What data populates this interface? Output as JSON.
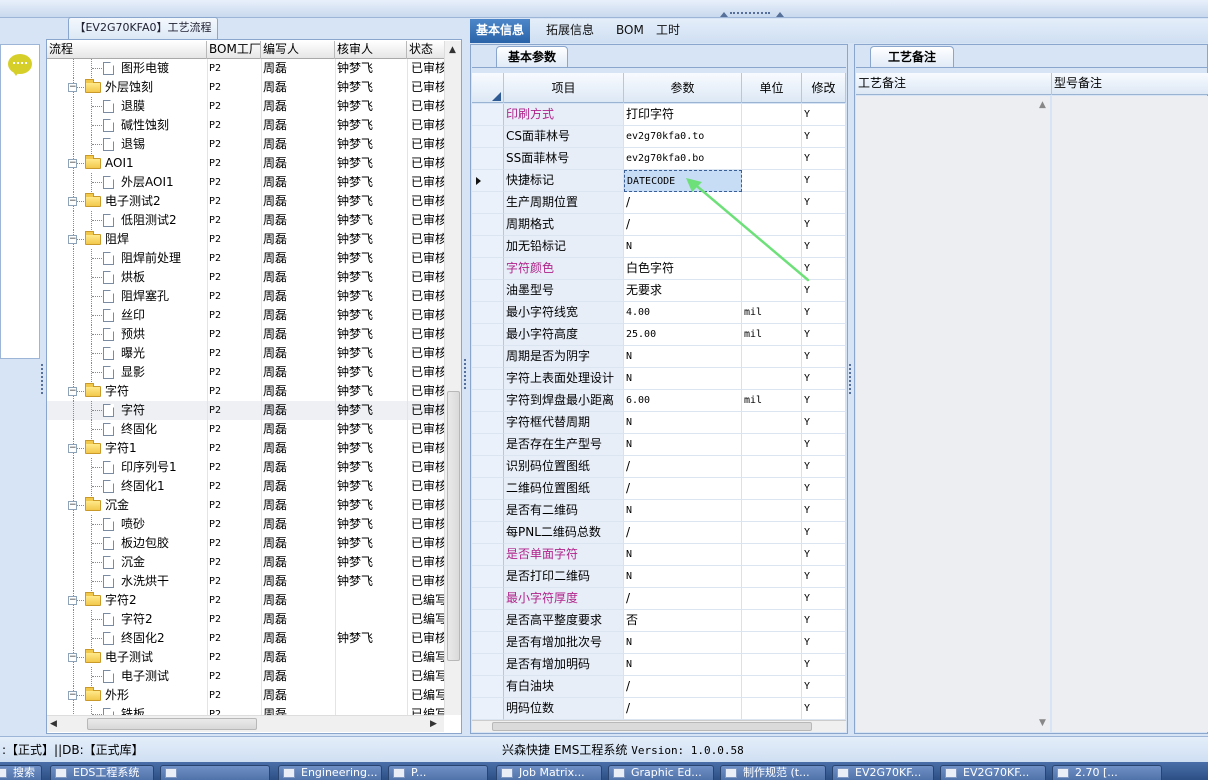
{
  "process_panel": {
    "tab_title": "【EV2G70KFA0】工艺流程",
    "columns": [
      "流程",
      "BOM工厂",
      "编写人",
      "核审人",
      "状态"
    ],
    "rows": [
      {
        "level": 2,
        "type": "doc",
        "name": "图形电镀",
        "bom": "P2",
        "writer": "周磊",
        "reviewer": "钟梦飞",
        "status": "已审核"
      },
      {
        "level": 1,
        "type": "folder",
        "name": "外层蚀刻",
        "bom": "P2",
        "writer": "周磊",
        "reviewer": "钟梦飞",
        "status": "已审核"
      },
      {
        "level": 2,
        "type": "doc",
        "name": "退膜",
        "bom": "P2",
        "writer": "周磊",
        "reviewer": "钟梦飞",
        "status": "已审核"
      },
      {
        "level": 2,
        "type": "doc",
        "name": "碱性蚀刻",
        "bom": "P2",
        "writer": "周磊",
        "reviewer": "钟梦飞",
        "status": "已审核"
      },
      {
        "level": 2,
        "type": "doc",
        "name": "退锡",
        "bom": "P2",
        "writer": "周磊",
        "reviewer": "钟梦飞",
        "status": "已审核"
      },
      {
        "level": 1,
        "type": "folder",
        "name": "AOI1",
        "bom": "P2",
        "writer": "周磊",
        "reviewer": "钟梦飞",
        "status": "已审核"
      },
      {
        "level": 2,
        "type": "doc",
        "name": "外层AOI1",
        "bom": "P2",
        "writer": "周磊",
        "reviewer": "钟梦飞",
        "status": "已审核"
      },
      {
        "level": 1,
        "type": "folder",
        "name": "电子测试2",
        "bom": "P2",
        "writer": "周磊",
        "reviewer": "钟梦飞",
        "status": "已审核"
      },
      {
        "level": 2,
        "type": "doc",
        "name": "低阻测试2",
        "bom": "P2",
        "writer": "周磊",
        "reviewer": "钟梦飞",
        "status": "已审核"
      },
      {
        "level": 1,
        "type": "folder",
        "name": "阻焊",
        "bom": "P2",
        "writer": "周磊",
        "reviewer": "钟梦飞",
        "status": "已审核"
      },
      {
        "level": 2,
        "type": "doc",
        "name": "阻焊前处理",
        "bom": "P2",
        "writer": "周磊",
        "reviewer": "钟梦飞",
        "status": "已审核"
      },
      {
        "level": 2,
        "type": "doc",
        "name": "烘板",
        "bom": "P2",
        "writer": "周磊",
        "reviewer": "钟梦飞",
        "status": "已审核"
      },
      {
        "level": 2,
        "type": "doc",
        "name": "阻焊塞孔",
        "bom": "P2",
        "writer": "周磊",
        "reviewer": "钟梦飞",
        "status": "已审核"
      },
      {
        "level": 2,
        "type": "doc",
        "name": "丝印",
        "bom": "P2",
        "writer": "周磊",
        "reviewer": "钟梦飞",
        "status": "已审核"
      },
      {
        "level": 2,
        "type": "doc",
        "name": "预烘",
        "bom": "P2",
        "writer": "周磊",
        "reviewer": "钟梦飞",
        "status": "已审核"
      },
      {
        "level": 2,
        "type": "doc",
        "name": "曝光",
        "bom": "P2",
        "writer": "周磊",
        "reviewer": "钟梦飞",
        "status": "已审核"
      },
      {
        "level": 2,
        "type": "doc",
        "name": "显影",
        "bom": "P2",
        "writer": "周磊",
        "reviewer": "钟梦飞",
        "status": "已审核"
      },
      {
        "level": 1,
        "type": "folder",
        "name": "字符",
        "bom": "P2",
        "writer": "周磊",
        "reviewer": "钟梦飞",
        "status": "已审核"
      },
      {
        "level": 2,
        "type": "doc",
        "name": "字符",
        "bom": "P2",
        "writer": "周磊",
        "reviewer": "钟梦飞",
        "status": "已审核",
        "selected": true
      },
      {
        "level": 2,
        "type": "doc",
        "name": "终固化",
        "bom": "P2",
        "writer": "周磊",
        "reviewer": "钟梦飞",
        "status": "已审核"
      },
      {
        "level": 1,
        "type": "folder",
        "name": "字符1",
        "bom": "P2",
        "writer": "周磊",
        "reviewer": "钟梦飞",
        "status": "已审核"
      },
      {
        "level": 2,
        "type": "doc",
        "name": "印序列号1",
        "bom": "P2",
        "writer": "周磊",
        "reviewer": "钟梦飞",
        "status": "已审核"
      },
      {
        "level": 2,
        "type": "doc",
        "name": "终固化1",
        "bom": "P2",
        "writer": "周磊",
        "reviewer": "钟梦飞",
        "status": "已审核"
      },
      {
        "level": 1,
        "type": "folder",
        "name": "沉金",
        "bom": "P2",
        "writer": "周磊",
        "reviewer": "钟梦飞",
        "status": "已审核"
      },
      {
        "level": 2,
        "type": "doc",
        "name": "喷砂",
        "bom": "P2",
        "writer": "周磊",
        "reviewer": "钟梦飞",
        "status": "已审核"
      },
      {
        "level": 2,
        "type": "doc",
        "name": "板边包胶",
        "bom": "P2",
        "writer": "周磊",
        "reviewer": "钟梦飞",
        "status": "已审核"
      },
      {
        "level": 2,
        "type": "doc",
        "name": "沉金",
        "bom": "P2",
        "writer": "周磊",
        "reviewer": "钟梦飞",
        "status": "已审核"
      },
      {
        "level": 2,
        "type": "doc",
        "name": "水洗烘干",
        "bom": "P2",
        "writer": "周磊",
        "reviewer": "钟梦飞",
        "status": "已审核"
      },
      {
        "level": 1,
        "type": "folder",
        "name": "字符2",
        "bom": "P2",
        "writer": "周磊",
        "reviewer": "",
        "status": "已编写"
      },
      {
        "level": 2,
        "type": "doc",
        "name": "字符2",
        "bom": "P2",
        "writer": "周磊",
        "reviewer": "",
        "status": "已编写"
      },
      {
        "level": 2,
        "type": "doc",
        "name": "终固化2",
        "bom": "P2",
        "writer": "周磊",
        "reviewer": "钟梦飞",
        "status": "已审核"
      },
      {
        "level": 1,
        "type": "folder",
        "name": "电子测试",
        "bom": "P2",
        "writer": "周磊",
        "reviewer": "",
        "status": "已编写"
      },
      {
        "level": 2,
        "type": "doc",
        "name": "电子测试",
        "bom": "P2",
        "writer": "周磊",
        "reviewer": "",
        "status": "已编写"
      },
      {
        "level": 1,
        "type": "folder",
        "name": "外形",
        "bom": "P2",
        "writer": "周磊",
        "reviewer": "",
        "status": "已编写"
      },
      {
        "level": 2,
        "type": "doc",
        "name": "铣板",
        "bom": "P2",
        "writer": "周磊",
        "reviewer": "",
        "status": "已编写"
      }
    ]
  },
  "middle_panel": {
    "tabs": [
      "基本信息",
      "拓展信息",
      "BOM",
      "工时"
    ],
    "sub_tab": "基本参数",
    "columns": [
      "项目",
      "参数",
      "单位",
      "修改"
    ],
    "rows": [
      {
        "item": "印刷方式",
        "param": "打印字符",
        "unit": "",
        "mod": "Y",
        "pink": true
      },
      {
        "item": "CS面菲林号",
        "param": "ev2g70kfa0.to",
        "unit": "",
        "mod": "Y",
        "mono": true
      },
      {
        "item": "SS面菲林号",
        "param": "ev2g70kfa0.bo",
        "unit": "",
        "mod": "Y",
        "mono": true
      },
      {
        "item": "快捷标记",
        "param": "DATECODE",
        "unit": "",
        "mod": "Y",
        "mono": true,
        "current": true
      },
      {
        "item": "生产周期位置",
        "param": "/",
        "unit": "",
        "mod": "Y"
      },
      {
        "item": "周期格式",
        "param": "/",
        "unit": "",
        "mod": "Y"
      },
      {
        "item": "加无铅标记",
        "param": "N",
        "unit": "",
        "mod": "Y",
        "mono": true
      },
      {
        "item": "字符颜色",
        "param": "白色字符",
        "unit": "",
        "mod": "Y",
        "pink": true
      },
      {
        "item": "油墨型号",
        "param": "无要求",
        "unit": "",
        "mod": "Y"
      },
      {
        "item": "最小字符线宽",
        "param": "4.00",
        "unit": "mil",
        "mod": "Y",
        "mono": true
      },
      {
        "item": "最小字符高度",
        "param": "25.00",
        "unit": "mil",
        "mod": "Y",
        "mono": true
      },
      {
        "item": "周期是否为阴字",
        "param": "N",
        "unit": "",
        "mod": "Y",
        "mono": true
      },
      {
        "item": "字符上表面处理设计",
        "param": "N",
        "unit": "",
        "mod": "Y",
        "mono": true
      },
      {
        "item": "字符到焊盘最小距离",
        "param": "6.00",
        "unit": "mil",
        "mod": "Y",
        "mono": true
      },
      {
        "item": "字符框代替周期",
        "param": "N",
        "unit": "",
        "mod": "Y",
        "mono": true
      },
      {
        "item": "是否存在生产型号",
        "param": "N",
        "unit": "",
        "mod": "Y",
        "mono": true
      },
      {
        "item": "识别码位置图纸",
        "param": "/",
        "unit": "",
        "mod": "Y"
      },
      {
        "item": "二维码位置图纸",
        "param": "/",
        "unit": "",
        "mod": "Y"
      },
      {
        "item": "是否有二维码",
        "param": "N",
        "unit": "",
        "mod": "Y",
        "mono": true
      },
      {
        "item": "每PNL二维码总数",
        "param": "/",
        "unit": "",
        "mod": "Y"
      },
      {
        "item": "是否单面字符",
        "param": "N",
        "unit": "",
        "mod": "Y",
        "mono": true,
        "pink": true
      },
      {
        "item": "是否打印二维码",
        "param": "N",
        "unit": "",
        "mod": "Y",
        "mono": true
      },
      {
        "item": "最小字符厚度",
        "param": "/",
        "unit": "",
        "mod": "Y",
        "pink": true
      },
      {
        "item": "是否高平整度要求",
        "param": "否",
        "unit": "",
        "mod": "Y"
      },
      {
        "item": "是否有增加批次号",
        "param": "N",
        "unit": "",
        "mod": "Y",
        "mono": true
      },
      {
        "item": "是否有增加明码",
        "param": "N",
        "unit": "",
        "mod": "Y",
        "mono": true
      },
      {
        "item": "有白油块",
        "param": "/",
        "unit": "",
        "mod": "Y"
      },
      {
        "item": "明码位数",
        "param": "/",
        "unit": "",
        "mod": "Y"
      }
    ]
  },
  "right_panel": {
    "tab": "工艺备注",
    "columns": [
      "工艺备注",
      "型号备注"
    ]
  },
  "status_bar": {
    "left": ":【正式】||DB:【正式库】",
    "app_name": "兴森快捷 EMS工程系统",
    "version": "Version: 1.0.0.58"
  },
  "taskbar": {
    "buttons": [
      "搜索",
      "EDS工程系统",
      "",
      "Engineering...",
      "P...",
      "Job Matrix...",
      "Graphic Ed...",
      "制作规范 (t...",
      "EV2G70KF...",
      "EV2G70KF...",
      "2.70 [..."
    ]
  },
  "colors": {
    "accent_tab": "#2a63a8",
    "pink_label": "#b0238a",
    "panel_bg": "#d6e4f5",
    "arrow": "#6ee07a"
  }
}
